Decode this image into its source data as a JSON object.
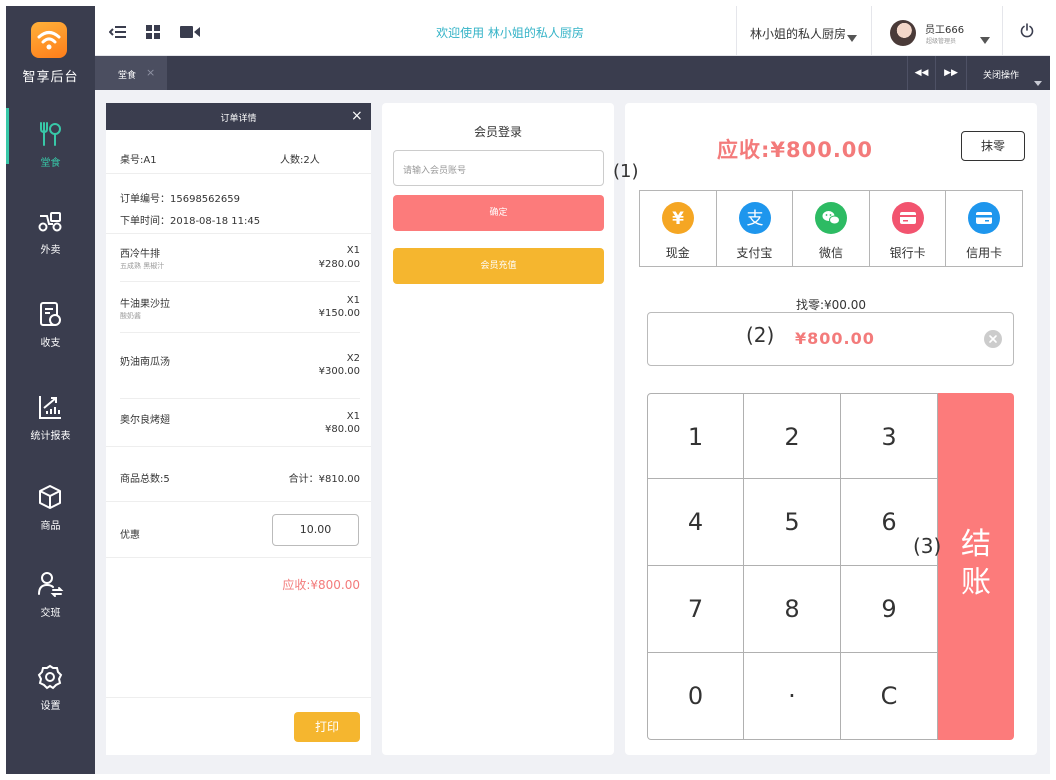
{
  "app": {
    "logo_text": "智享后台",
    "welcome": "欢迎使用  林小姐的私人厨房",
    "store_name": "林小姐的私人厨房",
    "user_name": "员工666",
    "user_role": "超级管理员"
  },
  "sidebar": {
    "items": [
      {
        "label": "堂食",
        "icon": "dine-in-icon"
      },
      {
        "label": "外卖",
        "icon": "delivery-icon"
      },
      {
        "label": "收支",
        "icon": "ledger-icon"
      },
      {
        "label": "统计报表",
        "icon": "report-icon"
      },
      {
        "label": "商品",
        "icon": "cube-icon"
      },
      {
        "label": "交班",
        "icon": "shift-handover-icon"
      },
      {
        "label": "设置",
        "icon": "settings-icon"
      }
    ]
  },
  "tabs": {
    "items": [
      {
        "label": "堂食",
        "close": "×"
      }
    ],
    "prev": "◀◀",
    "next": "▶▶",
    "close_ops": "关闭操作"
  },
  "order": {
    "header": "订单详情",
    "close": "×",
    "table": "桌号:A1",
    "people": "人数:2人",
    "order_no": "订单编号：15698562659",
    "order_time": "下单时间：2018-08-18 11:45",
    "items": [
      {
        "name": "西冷牛排",
        "note": "五成熟 黑椒汁",
        "qty": "X1",
        "price": "¥280.00"
      },
      {
        "name": "牛油果沙拉",
        "note": "酸奶酱",
        "qty": "X1",
        "price": "¥150.00"
      },
      {
        "name": "奶油南瓜汤",
        "note": "",
        "qty": "X2",
        "price": "¥300.00"
      },
      {
        "name": "奥尔良烤翅",
        "note": "",
        "qty": "X1",
        "price": "¥80.00"
      }
    ],
    "total_count": "商品总数:5",
    "total_sum": "合计：¥810.00",
    "discount_label": "优惠",
    "discount_value": "10.00",
    "due": "应收:¥800.00",
    "print": "打印"
  },
  "member": {
    "title": "会员登录",
    "placeholder": "请输入会员账号",
    "confirm": "确定",
    "recharge": "会员充值"
  },
  "payment": {
    "due": "应收:¥800.00",
    "round_off": "抹零",
    "methods": [
      {
        "label": "现金",
        "icon": "cash-yen-icon",
        "color": "#f5a623",
        "glyph": "¥"
      },
      {
        "label": "支付宝",
        "icon": "alipay-icon",
        "color": "#1e96ed",
        "glyph": "支"
      },
      {
        "label": "微信",
        "icon": "wechat-icon",
        "color": "#2dbb63",
        "glyph": ""
      },
      {
        "label": "银行卡",
        "icon": "bank-card-icon",
        "color": "#f2546f",
        "glyph": ""
      },
      {
        "label": "信用卡",
        "icon": "credit-card-icon",
        "color": "#1e96ed",
        "glyph": ""
      }
    ],
    "change": "找零:¥00.00",
    "amount": "¥800.00",
    "keys": [
      "1",
      "2",
      "3",
      "4",
      "5",
      "6",
      "7",
      "8",
      "9",
      "0",
      "·",
      "C"
    ],
    "checkout": "结\n账"
  },
  "annotations": {
    "a1": "(1)",
    "a2": "(2)",
    "a3": "(3)"
  },
  "colors": {
    "sidebar": "#3a3d4e",
    "accent_teal": "#38c8a8",
    "welcome_text": "#34b3c7",
    "due_red": "#f37b7b",
    "confirm_red": "#fc7b7b",
    "orange": "#f5b62f"
  }
}
